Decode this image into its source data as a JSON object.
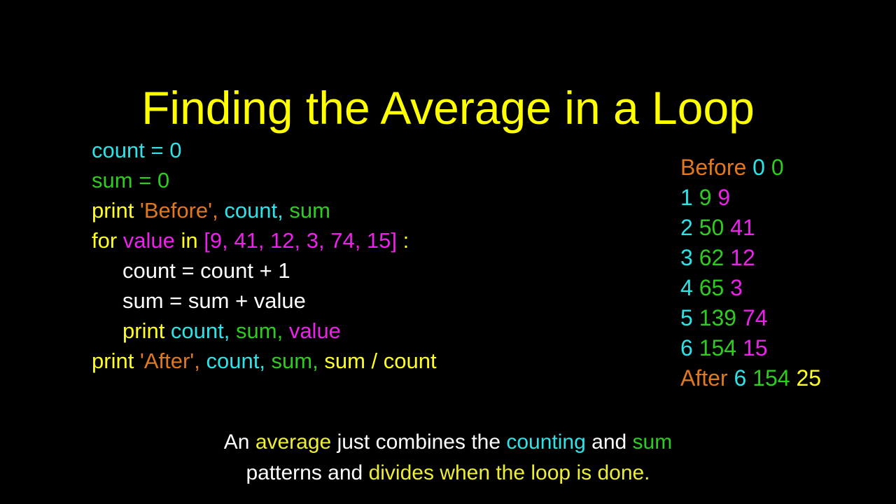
{
  "slide": {
    "title": "Finding the Average in a Loop",
    "background_color": "#000000"
  },
  "palette": {
    "title_yellow": "#ffff00",
    "keyword_yellow": "#ffff22",
    "caption_yellow": "#eeee33",
    "count_cyan": "#2ee3e8",
    "sum_green": "#2ecc1f",
    "string_orange": "#e0781e",
    "value_magenta": "#ea22ea",
    "white": "#ffffff"
  },
  "code": {
    "lines": [
      {
        "indent": false,
        "tokens": [
          {
            "text": "count",
            "color": "cyan"
          },
          {
            "text": " = ",
            "color": "cyan"
          },
          {
            "text": "0",
            "color": "cyan"
          }
        ]
      },
      {
        "indent": false,
        "tokens": [
          {
            "text": "sum",
            "color": "green"
          },
          {
            "text": " = ",
            "color": "green"
          },
          {
            "text": "0",
            "color": "green"
          }
        ]
      },
      {
        "indent": false,
        "tokens": [
          {
            "text": "print ",
            "color": "yellow"
          },
          {
            "text": "'Before'",
            "color": "orange"
          },
          {
            "text": ", ",
            "color": "orange"
          },
          {
            "text": "count",
            "color": "cyan"
          },
          {
            "text": ", ",
            "color": "cyan"
          },
          {
            "text": "sum",
            "color": "green"
          }
        ]
      },
      {
        "indent": false,
        "tokens": [
          {
            "text": "for ",
            "color": "yellow"
          },
          {
            "text": "value",
            "color": "magenta"
          },
          {
            "text": " in ",
            "color": "yellow"
          },
          {
            "text": "[9, 41, 12, 3, 74, 15]",
            "color": "magenta"
          },
          {
            "text": " :",
            "color": "yellow"
          }
        ]
      },
      {
        "indent": true,
        "tokens": [
          {
            "text": "count = count + 1",
            "color": "white"
          }
        ]
      },
      {
        "indent": true,
        "tokens": [
          {
            "text": "sum = sum + value",
            "color": "white"
          }
        ]
      },
      {
        "indent": true,
        "tokens": [
          {
            "text": "print ",
            "color": "yellow"
          },
          {
            "text": "count",
            "color": "cyan"
          },
          {
            "text": ", ",
            "color": "cyan"
          },
          {
            "text": "sum",
            "color": "green"
          },
          {
            "text": ", ",
            "color": "green"
          },
          {
            "text": "value",
            "color": "magenta"
          }
        ]
      },
      {
        "indent": false,
        "tokens": [
          {
            "text": "print ",
            "color": "yellow"
          },
          {
            "text": "'After'",
            "color": "orange"
          },
          {
            "text": ", ",
            "color": "orange"
          },
          {
            "text": "count",
            "color": "cyan"
          },
          {
            "text": ", ",
            "color": "cyan"
          },
          {
            "text": "sum",
            "color": "green"
          },
          {
            "text": ", ",
            "color": "green"
          },
          {
            "text": "sum / count",
            "color": "yellow"
          }
        ]
      }
    ]
  },
  "output": {
    "lines": [
      {
        "tokens": [
          {
            "text": "Before",
            "color": "orange"
          },
          {
            "text": " ",
            "color": "white"
          },
          {
            "text": "0",
            "color": "cyan"
          },
          {
            "text": " ",
            "color": "white"
          },
          {
            "text": "0",
            "color": "green"
          }
        ]
      },
      {
        "tokens": [
          {
            "text": "1",
            "color": "cyan"
          },
          {
            "text": " ",
            "color": "white"
          },
          {
            "text": "9",
            "color": "green"
          },
          {
            "text": " ",
            "color": "white"
          },
          {
            "text": "9",
            "color": "magenta"
          }
        ]
      },
      {
        "tokens": [
          {
            "text": "2",
            "color": "cyan"
          },
          {
            "text": " ",
            "color": "white"
          },
          {
            "text": "50",
            "color": "green"
          },
          {
            "text": " ",
            "color": "white"
          },
          {
            "text": "41",
            "color": "magenta"
          }
        ]
      },
      {
        "tokens": [
          {
            "text": "3",
            "color": "cyan"
          },
          {
            "text": " ",
            "color": "white"
          },
          {
            "text": "62",
            "color": "green"
          },
          {
            "text": " ",
            "color": "white"
          },
          {
            "text": "12",
            "color": "magenta"
          }
        ]
      },
      {
        "tokens": [
          {
            "text": "4",
            "color": "cyan"
          },
          {
            "text": " ",
            "color": "white"
          },
          {
            "text": "65",
            "color": "green"
          },
          {
            "text": " ",
            "color": "white"
          },
          {
            "text": "3",
            "color": "magenta"
          }
        ]
      },
      {
        "tokens": [
          {
            "text": "5",
            "color": "cyan"
          },
          {
            "text": " ",
            "color": "white"
          },
          {
            "text": "139",
            "color": "green"
          },
          {
            "text": " ",
            "color": "white"
          },
          {
            "text": "74",
            "color": "magenta"
          }
        ]
      },
      {
        "tokens": [
          {
            "text": "6",
            "color": "cyan"
          },
          {
            "text": " ",
            "color": "white"
          },
          {
            "text": "154",
            "color": "green"
          },
          {
            "text": " ",
            "color": "white"
          },
          {
            "text": "15",
            "color": "magenta"
          }
        ]
      },
      {
        "tokens": [
          {
            "text": "After",
            "color": "orange"
          },
          {
            "text": " ",
            "color": "white"
          },
          {
            "text": "6",
            "color": "cyan"
          },
          {
            "text": " ",
            "color": "white"
          },
          {
            "text": "154",
            "color": "green"
          },
          {
            "text": " ",
            "color": "white"
          },
          {
            "text": "25",
            "color": "yellow"
          }
        ]
      }
    ]
  },
  "caption": {
    "lines": [
      {
        "tokens": [
          {
            "text": "An ",
            "color": "white"
          },
          {
            "text": "average",
            "color": "softyel"
          },
          {
            "text": " just combines the ",
            "color": "white"
          },
          {
            "text": "counting",
            "color": "cyan"
          },
          {
            "text": " and ",
            "color": "white"
          },
          {
            "text": "sum",
            "color": "green"
          }
        ]
      },
      {
        "tokens": [
          {
            "text": "patterns and ",
            "color": "white"
          },
          {
            "text": "divides when the loop is done.",
            "color": "softyel"
          }
        ]
      }
    ]
  }
}
